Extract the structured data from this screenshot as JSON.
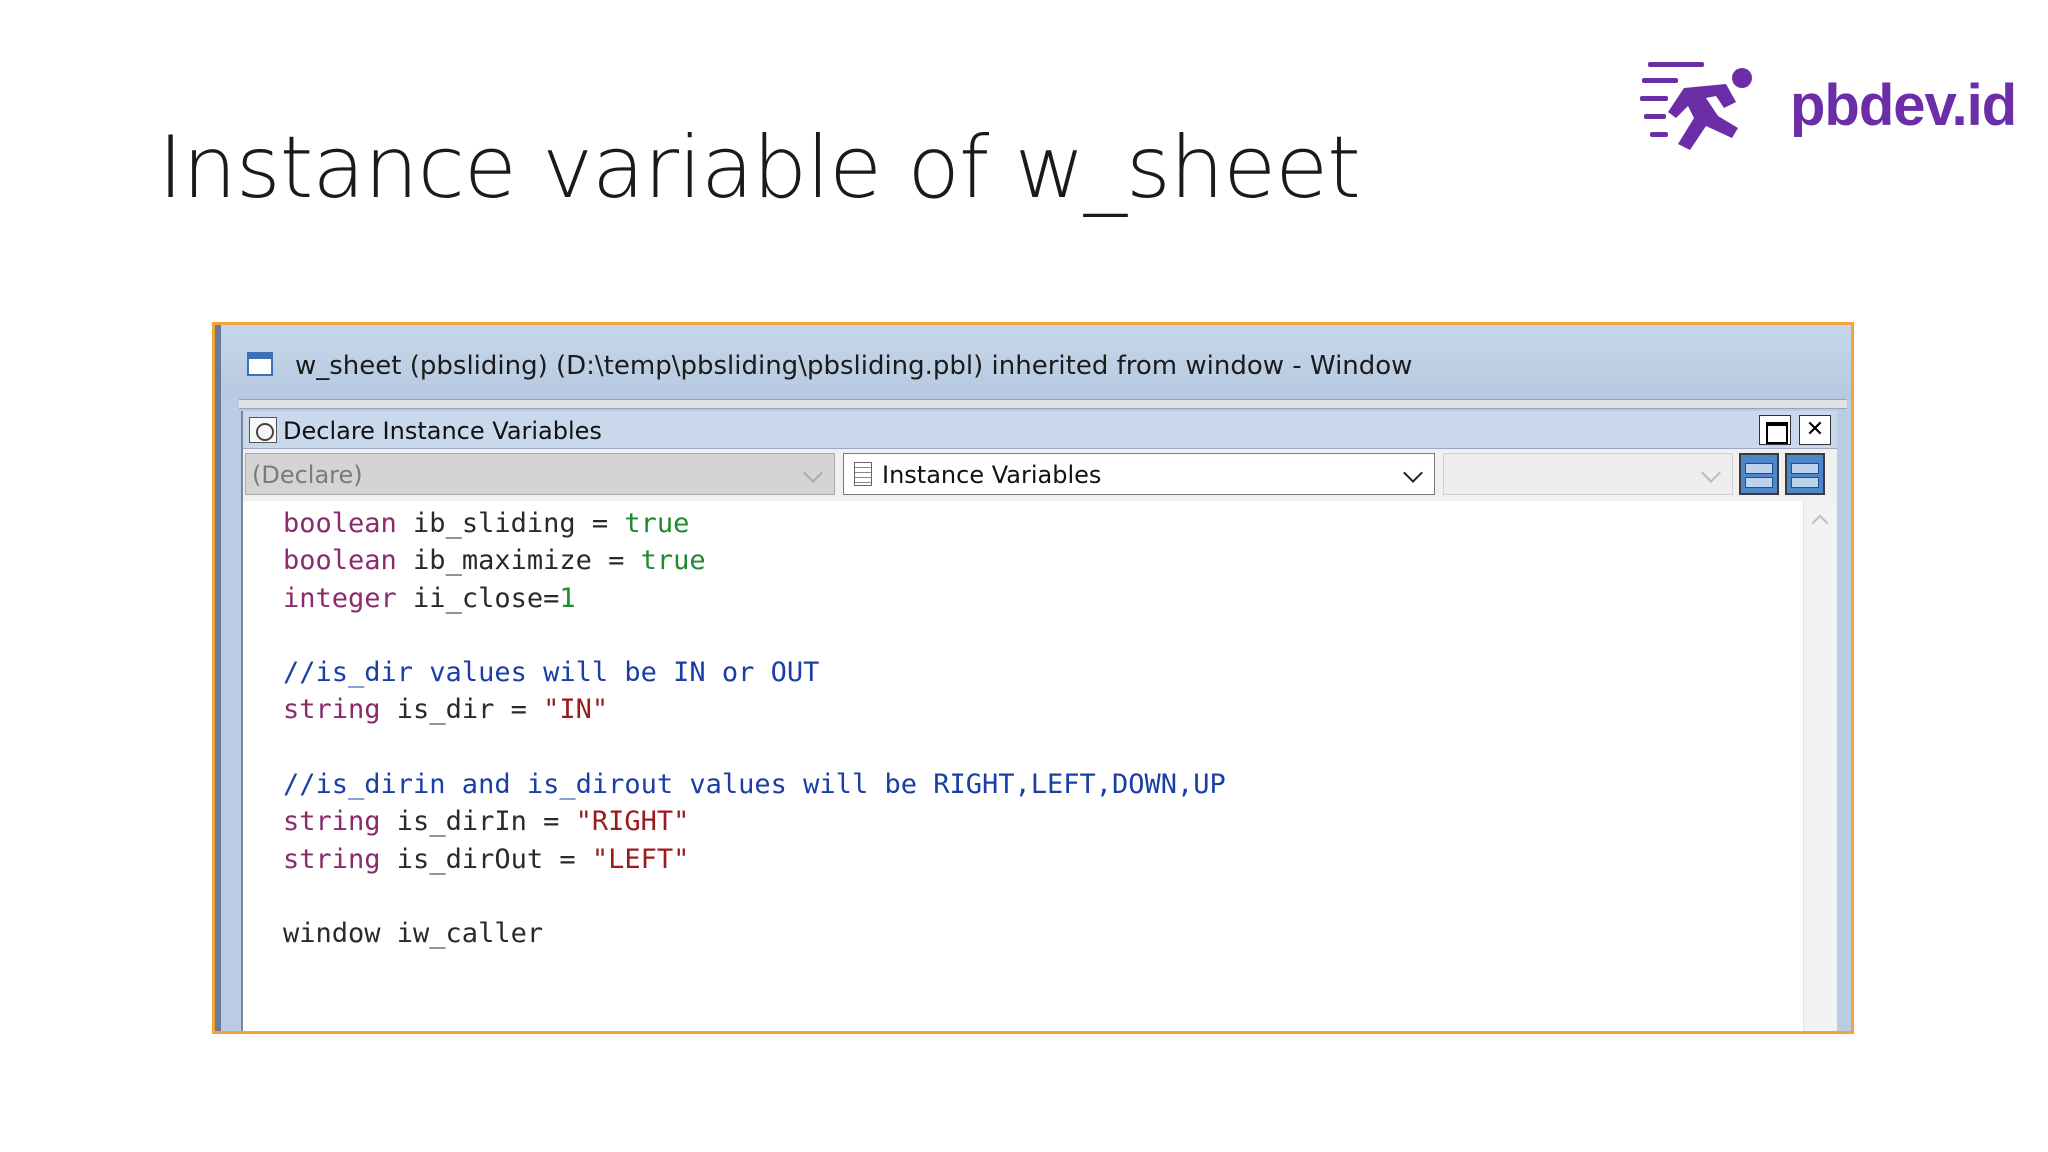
{
  "slide": {
    "title": "Instance variable of w_sheet"
  },
  "logo": {
    "text": "pbdev.id",
    "icon": "running-person-icon",
    "color": "#6b2ea7"
  },
  "window": {
    "title": "w_sheet (pbsliding) (D:\\temp\\pbsliding\\pbsliding.pbl) inherited from window - Window",
    "icon": "window-icon",
    "border_color": "#f2a53a"
  },
  "panel": {
    "title": "Declare Instance Variables",
    "icon": "script-icon",
    "maximize_icon": "maximize-icon",
    "close_label": "✕"
  },
  "toolbar": {
    "declare_dropdown": "(Declare)",
    "instance_dropdown": "Instance Variables",
    "third_dropdown": ""
  },
  "code": {
    "lines": [
      [
        {
          "t": "boolean",
          "c": "kw"
        },
        {
          "t": " ib_sliding = ",
          "c": "id"
        },
        {
          "t": "true",
          "c": "lit"
        }
      ],
      [
        {
          "t": "boolean",
          "c": "kw"
        },
        {
          "t": " ib_maximize = ",
          "c": "id"
        },
        {
          "t": "true",
          "c": "lit"
        }
      ],
      [
        {
          "t": "integer",
          "c": "kw"
        },
        {
          "t": " ii_close=",
          "c": "id"
        },
        {
          "t": "1",
          "c": "num"
        }
      ],
      [],
      [
        {
          "t": "//is_dir values will be IN or OUT",
          "c": "cmt"
        }
      ],
      [
        {
          "t": "string",
          "c": "kw"
        },
        {
          "t": " is_dir = ",
          "c": "id"
        },
        {
          "t": "\"IN\"",
          "c": "str"
        }
      ],
      [],
      [
        {
          "t": "//is_dirin and is_dirout values will be RIGHT,LEFT,DOWN,UP",
          "c": "cmt"
        }
      ],
      [
        {
          "t": "string",
          "c": "kw"
        },
        {
          "t": " is_dirIn = ",
          "c": "id"
        },
        {
          "t": "\"RIGHT\"",
          "c": "str"
        }
      ],
      [
        {
          "t": "string",
          "c": "kw"
        },
        {
          "t": " is_dirOut = ",
          "c": "id"
        },
        {
          "t": "\"LEFT\"",
          "c": "str"
        }
      ],
      [],
      [
        {
          "t": "window iw_caller",
          "c": "id"
        }
      ]
    ]
  }
}
